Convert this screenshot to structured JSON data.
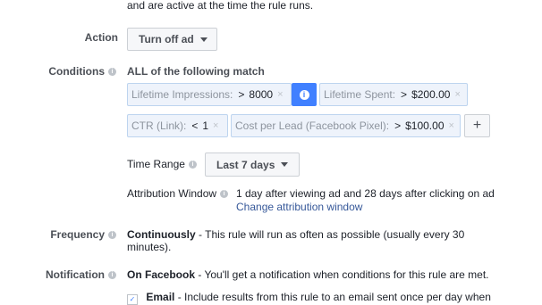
{
  "top_text": "and are active at the time the rule runs.",
  "action": {
    "label": "Action",
    "value": "Turn off ad"
  },
  "conditions": {
    "label": "Conditions",
    "heading": "ALL of the following match",
    "chips": [
      {
        "key": "Lifetime Impressions:",
        "op": ">",
        "value": "8000"
      },
      {
        "key": "Lifetime Spent:",
        "op": ">",
        "value": "$200.00"
      },
      {
        "key": "CTR (Link):",
        "op": "<",
        "value": "1"
      },
      {
        "key": "Cost per Lead (Facebook Pixel):",
        "op": ">",
        "value": "$100.00"
      }
    ],
    "add": "+",
    "info": "i"
  },
  "time_range": {
    "label": "Time Range",
    "value": "Last 7 days"
  },
  "attribution": {
    "label": "Attribution Window",
    "text": "1 day after viewing ad and 28 days after clicking on ad",
    "link": "Change attribution window"
  },
  "frequency": {
    "label": "Frequency",
    "bold": "Continuously",
    "rest": " - This rule will run as often as possible (usually every 30",
    "rest2": "minutes)."
  },
  "notification": {
    "label": "Notification",
    "bold": "On Facebook",
    "rest": " - You'll get a notification when conditions for this rule are met."
  },
  "email_partial": {
    "bold": "Email",
    "rest": " - Include results from this rule to an email sent once per day when"
  },
  "x_glyph": "×",
  "info_glyph": "i",
  "check_glyph": "✓"
}
